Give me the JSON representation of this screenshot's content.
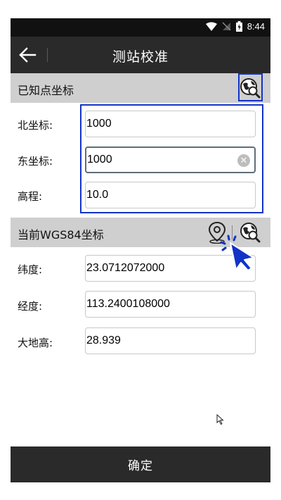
{
  "status_bar": {
    "time": "8:44"
  },
  "title_bar": {
    "title": "测站校准"
  },
  "known_section": {
    "title": "已知点坐标",
    "fields": [
      {
        "label": "北坐标:",
        "value": "1000"
      },
      {
        "label": "东坐标:",
        "value": "1000"
      },
      {
        "label": "高程:",
        "value": "10.0"
      }
    ]
  },
  "wgs_section": {
    "title": "当前WGS84坐标",
    "fields": [
      {
        "label": "纬度:",
        "value": "23.0712072000"
      },
      {
        "label": "经度:",
        "value": "113.2400108000"
      },
      {
        "label": "大地高:",
        "value": "28.939"
      }
    ]
  },
  "confirm_button": {
    "label": "确定"
  },
  "colors": {
    "highlight": "#1233c7",
    "title_bar": "#2a2a2a",
    "section_header": "#cfcfcf"
  },
  "icons": [
    "back-arrow-icon",
    "globe-search-icon",
    "location-pin-icon",
    "clear-icon",
    "wifi-icon",
    "battery-icon"
  ]
}
